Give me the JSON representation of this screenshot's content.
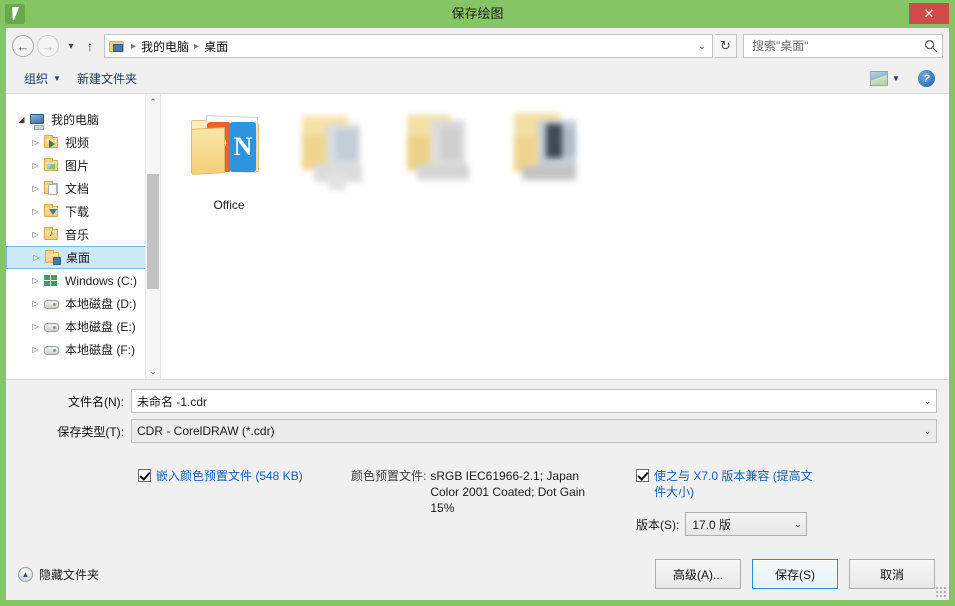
{
  "window": {
    "title": "保存绘图",
    "app_icon": "pen-nib-icon",
    "close_label": "✕",
    "accent_color": "#86c564",
    "close_color": "#cf4a4a"
  },
  "nav": {
    "back_label": "←",
    "forward_label": "→",
    "history_label": "▾",
    "up_label": "↑",
    "address_chevron": "⌄",
    "refresh_label": "↻",
    "breadcrumbs": [
      "我的电脑",
      "桌面"
    ],
    "separator": "▸"
  },
  "search": {
    "placeholder": "搜索\"桌面\"",
    "value": "",
    "icon": "search-icon"
  },
  "commandbar": {
    "organize_label": "组织",
    "organize_caret": "▼",
    "new_folder_label": "新建文件夹",
    "view_caret": "▼",
    "help_label": "?"
  },
  "sidebar": {
    "items": [
      {
        "label": "我的电脑",
        "level": 0,
        "twisty": "◢",
        "icon": "computer-icon",
        "selected": false
      },
      {
        "label": "视频",
        "level": 1,
        "twisty": "▷",
        "icon": "videos-folder-icon",
        "selected": false
      },
      {
        "label": "图片",
        "level": 1,
        "twisty": "▷",
        "icon": "pictures-folder-icon",
        "selected": false
      },
      {
        "label": "文档",
        "level": 1,
        "twisty": "▷",
        "icon": "documents-folder-icon",
        "selected": false
      },
      {
        "label": "下载",
        "level": 1,
        "twisty": "▷",
        "icon": "downloads-folder-icon",
        "selected": false
      },
      {
        "label": "音乐",
        "level": 1,
        "twisty": "▷",
        "icon": "music-folder-icon",
        "selected": false
      },
      {
        "label": "桌面",
        "level": 1,
        "twisty": "▷",
        "icon": "desktop-folder-icon",
        "selected": true
      },
      {
        "label": "Windows (C:)",
        "level": 1,
        "twisty": "▷",
        "icon": "windows-drive-icon",
        "selected": false
      },
      {
        "label": "本地磁盘 (D:)",
        "level": 1,
        "twisty": "▷",
        "icon": "disk-icon",
        "selected": false
      },
      {
        "label": "本地磁盘 (E:)",
        "level": 1,
        "twisty": "▷",
        "icon": "disk-icon",
        "selected": false
      },
      {
        "label": "本地磁盘 (F:)",
        "level": 1,
        "twisty": "▷",
        "icon": "disk-icon",
        "selected": false
      }
    ],
    "scroll_up": "⌃",
    "scroll_down": "⌄"
  },
  "files": {
    "items": [
      {
        "label": "Office",
        "kind": "folder",
        "redacted": false
      },
      {
        "label": "",
        "kind": "folder",
        "redacted": true
      },
      {
        "label": "",
        "kind": "folder",
        "redacted": true
      },
      {
        "label": "",
        "kind": "folder",
        "redacted": true
      }
    ]
  },
  "form": {
    "filename_label": "文件名(N):",
    "filename_value": "未命名 -1.cdr",
    "filetype_label": "保存类型(T):",
    "filetype_value": "CDR - CorelDRAW (*.cdr)",
    "caret": "⌄"
  },
  "options": {
    "embed_profile_checked": true,
    "embed_profile_label": "嵌入颜色预置文件 (548 KB)",
    "profile_caption": "颜色预置文件:",
    "profile_value": "sRGB IEC61966-2.1; Japan Color 2001 Coated; Dot Gain 15%",
    "compat_checked": true,
    "compat_label": "使之与 X7.0 版本兼容 (提高文件大小)",
    "version_label": "版本(S):",
    "version_value": "17.0 版",
    "version_caret": "⌄"
  },
  "footer": {
    "hide_folders_label": "隐藏文件夹",
    "hide_folders_icon": "▲",
    "advanced_label": "高级(A)...",
    "save_label": "保存(S)",
    "cancel_label": "取消"
  }
}
